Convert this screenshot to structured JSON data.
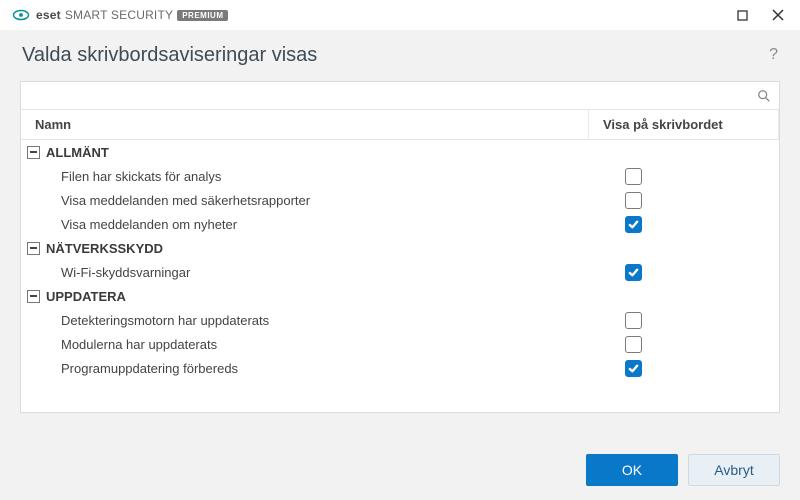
{
  "brand": {
    "eset": "eset",
    "name": "SMART SECURITY",
    "badge": "PREMIUM"
  },
  "dialog": {
    "title": "Valda skrivbordsaviseringar visas"
  },
  "search": {
    "placeholder": ""
  },
  "columns": {
    "name": "Namn",
    "show": "Visa på skrivbordet"
  },
  "groups": [
    {
      "label": "ALLMÄNT",
      "items": [
        {
          "label": "Filen har skickats för analys",
          "checked": false
        },
        {
          "label": "Visa meddelanden med säkerhetsrapporter",
          "checked": false
        },
        {
          "label": "Visa meddelanden om nyheter",
          "checked": true
        }
      ]
    },
    {
      "label": "NÄTVERKSSKYDD",
      "items": [
        {
          "label": "Wi-Fi-skyddsvarningar",
          "checked": true
        }
      ]
    },
    {
      "label": "UPPDATERA",
      "items": [
        {
          "label": "Detekteringsmotorn har uppdaterats",
          "checked": false
        },
        {
          "label": "Modulerna har uppdaterats",
          "checked": false
        },
        {
          "label": "Programuppdatering förbereds",
          "checked": true
        }
      ]
    }
  ],
  "buttons": {
    "ok": "OK",
    "cancel": "Avbryt"
  }
}
